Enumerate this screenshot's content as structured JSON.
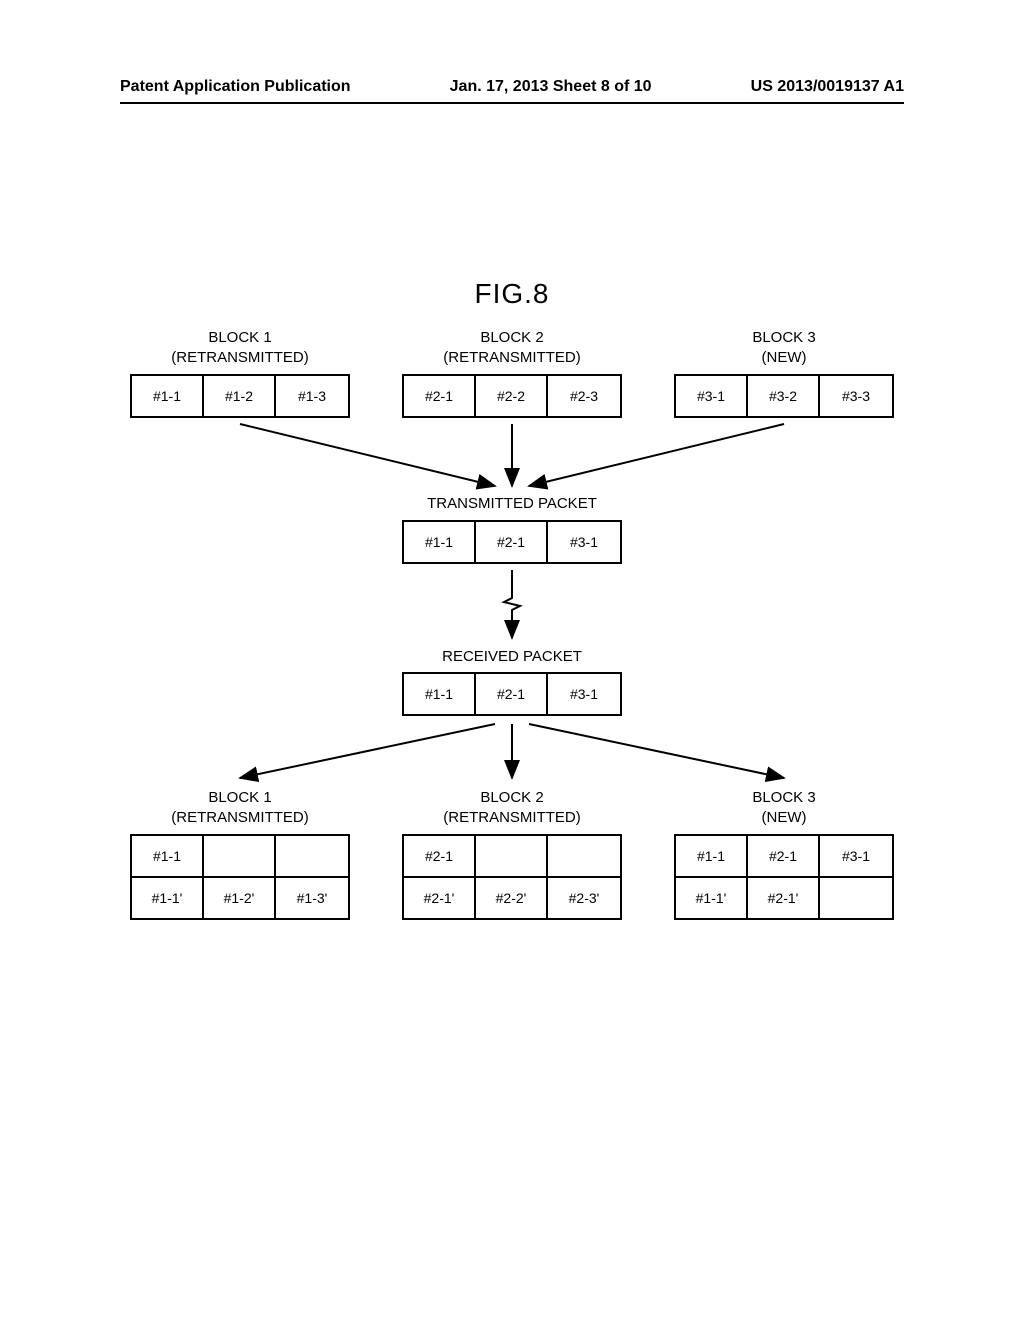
{
  "header": {
    "left": "Patent Application Publication",
    "center": "Jan. 17, 2013  Sheet 8 of 10",
    "right": "US 2013/0019137 A1"
  },
  "figure_title": "FIG.8",
  "top_blocks": {
    "block1": {
      "title": "BLOCK 1",
      "subtitle": "(RETRANSMITTED)",
      "cells": [
        "#1-1",
        "#1-2",
        "#1-3"
      ]
    },
    "block2": {
      "title": "BLOCK 2",
      "subtitle": "(RETRANSMITTED)",
      "cells": [
        "#2-1",
        "#2-2",
        "#2-3"
      ]
    },
    "block3": {
      "title": "BLOCK 3",
      "subtitle": "(NEW)",
      "cells": [
        "#3-1",
        "#3-2",
        "#3-3"
      ]
    }
  },
  "transmitted_label": "TRANSMITTED PACKET",
  "transmitted_packet": [
    "#1-1",
    "#2-1",
    "#3-1"
  ],
  "received_label": "RECEIVED PACKET",
  "received_packet": [
    "#1-1",
    "#2-1",
    "#3-1"
  ],
  "bottom_blocks": {
    "block1": {
      "title": "BLOCK 1",
      "subtitle": "(RETRANSMITTED)",
      "row1": [
        "#1-1",
        "",
        ""
      ],
      "row2": [
        "#1-1'",
        "#1-2'",
        "#1-3'"
      ]
    },
    "block2": {
      "title": "BLOCK 2",
      "subtitle": "(RETRANSMITTED)",
      "row1": [
        "#2-1",
        "",
        ""
      ],
      "row2": [
        "#2-1'",
        "#2-2'",
        "#2-3'"
      ]
    },
    "block3": {
      "title": "BLOCK 3",
      "subtitle": "(NEW)",
      "row1": [
        "#1-1",
        "#2-1",
        "#3-1"
      ],
      "row2": [
        "#1-1'",
        "#2-1'",
        ""
      ]
    }
  }
}
